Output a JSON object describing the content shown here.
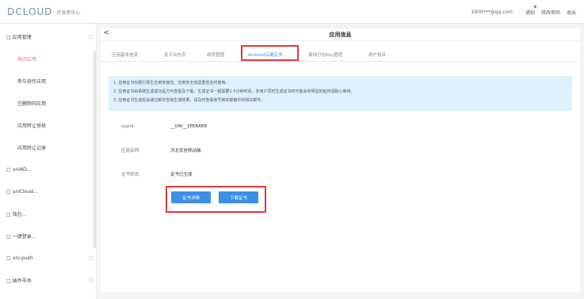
{
  "header": {
    "logo_text": "DCLOUD",
    "logo_sub": "开发者中心",
    "user_email": "1900***@qq.com",
    "links": [
      "通知",
      "修改密码",
      "退出"
    ]
  },
  "sidebar": {
    "items": [
      {
        "label": "应用管理",
        "arrow": "□"
      },
      {
        "label": "我的应用"
      },
      {
        "label": "参与协作应用"
      },
      {
        "label": "已删除的应用"
      },
      {
        "label": "应用转让审核"
      },
      {
        "label": "应用转让记录"
      },
      {
        "label": "uniAD..."
      },
      {
        "label": "uniCloud..."
      },
      {
        "label": "钱包..."
      },
      {
        "label": "一键登录..."
      },
      {
        "label": "uni-push",
        "arrow": "□"
      },
      {
        "label": "插件市场",
        "arrow": "□"
      }
    ],
    "group_prefix": "□"
  },
  "panel": {
    "back_glyph": "<",
    "title": "应用信息",
    "tabs": [
      "应用基本信息",
      "各平台信息",
      "成员管理",
      "Android云端证书",
      "离线打包Key管理",
      "用户投诉"
    ],
    "notice": [
      "1. 应用证书仅限打原生应用安装包、应用安全加固重签名时使用。",
      "2. 应用证书由系统生成成功后方可查看及下载，生成证书一般需要1-5分钟时间，多用户同时生成证书时可能会有明显的延时请耐心等待。",
      "3. 应用证书生成后会通过邮件告知生成结果，请及时查看账号绑定邮箱中的相关邮件。"
    ],
    "fields": [
      {
        "label": "appid:",
        "value": "__UNI__1EEBAEB"
      },
      {
        "label": "应用名称:",
        "value": "河北农信移动端"
      },
      {
        "label": "证书状态:",
        "value": "证书已生成"
      }
    ],
    "buttons": {
      "detail": "证书详情",
      "download": "下载证书"
    }
  }
}
